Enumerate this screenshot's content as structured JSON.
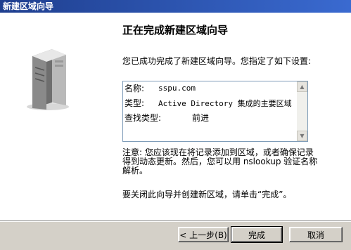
{
  "window": {
    "title": "新建区域向导"
  },
  "wizard": {
    "heading": "正在完成新建区域向导",
    "intro": "您已成功完成了新建区域向导。您指定了如下设置:",
    "settings": [
      {
        "label": "名称:",
        "value": "sspu.com"
      },
      {
        "label": "类型:",
        "value": "Active Directory 集成的主要区域"
      },
      {
        "label": "查找类型:",
        "value": "前进"
      }
    ],
    "note_line1": "注意: 您应该现在将记录添加到区域，或者确保记录",
    "note_line2": "得到动态更新。然后，您可以用 nslookup 验证名称",
    "note_line3": "解析。",
    "closing": "要关闭此向导并创建新区域，请单击“完成”。"
  },
  "buttons": {
    "back": "< 上一步(B)",
    "finish": "完成",
    "cancel": "取消"
  },
  "icons": {
    "server": "server-tower-icon",
    "scroll_up": "scroll-up-icon",
    "scroll_down": "scroll-down-icon"
  }
}
